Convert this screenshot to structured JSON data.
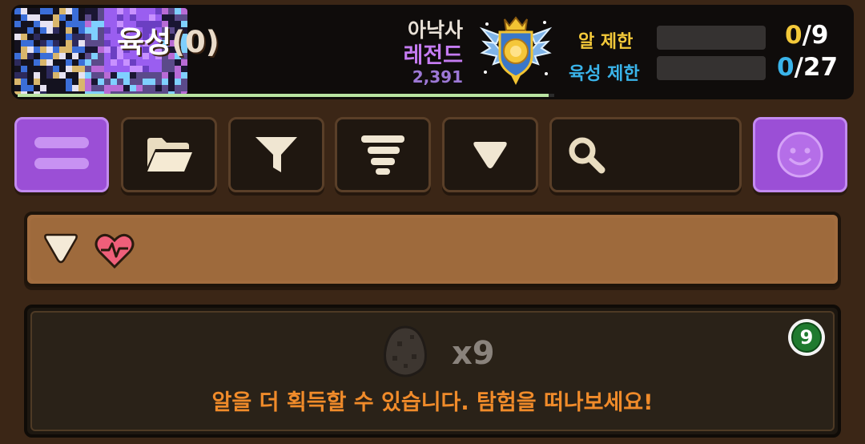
{
  "profile": {
    "player_name": "아낙사",
    "rank_name": "레전드",
    "rank_score": "2,391",
    "xp_progress": 0.99
  },
  "limits": {
    "egg_label": "알 제한",
    "egg_current": "0",
    "egg_max": "/9",
    "breed_label": "육성 제한",
    "breed_current": "0",
    "breed_max": "/27"
  },
  "toolbar": {
    "buttons": [
      "menu-button",
      "folder-button",
      "filter-button",
      "sort-button",
      "collapse-button",
      "search-box",
      "emote-button"
    ],
    "search_value": ""
  },
  "section": {
    "title": "육성",
    "count": "(0)"
  },
  "egg_panel": {
    "count": "x9",
    "badge_value": "9",
    "notice": "알을 더 획득할 수 있습니다. 탐험을 떠나보세요!"
  },
  "colors": {
    "background": "#3b2616",
    "accent_purple": "#9b4fd6",
    "egg_limit_label": "#f3c93a",
    "breed_limit_label": "#3ab4ea",
    "notice_orange": "#f08b2a",
    "rank_purple": "#c57cf2"
  },
  "icons": {
    "menu": "menu-icon",
    "folder": "folder-icon",
    "filter": "filter-icon",
    "sort": "sort-icon",
    "collapse": "triangle-down-icon",
    "search": "search-icon",
    "emote": "smiley-icon",
    "section_heart": "heart-pulse-icon",
    "egg": "egg-icon",
    "rank": "legend-rank-emblem-icon"
  }
}
